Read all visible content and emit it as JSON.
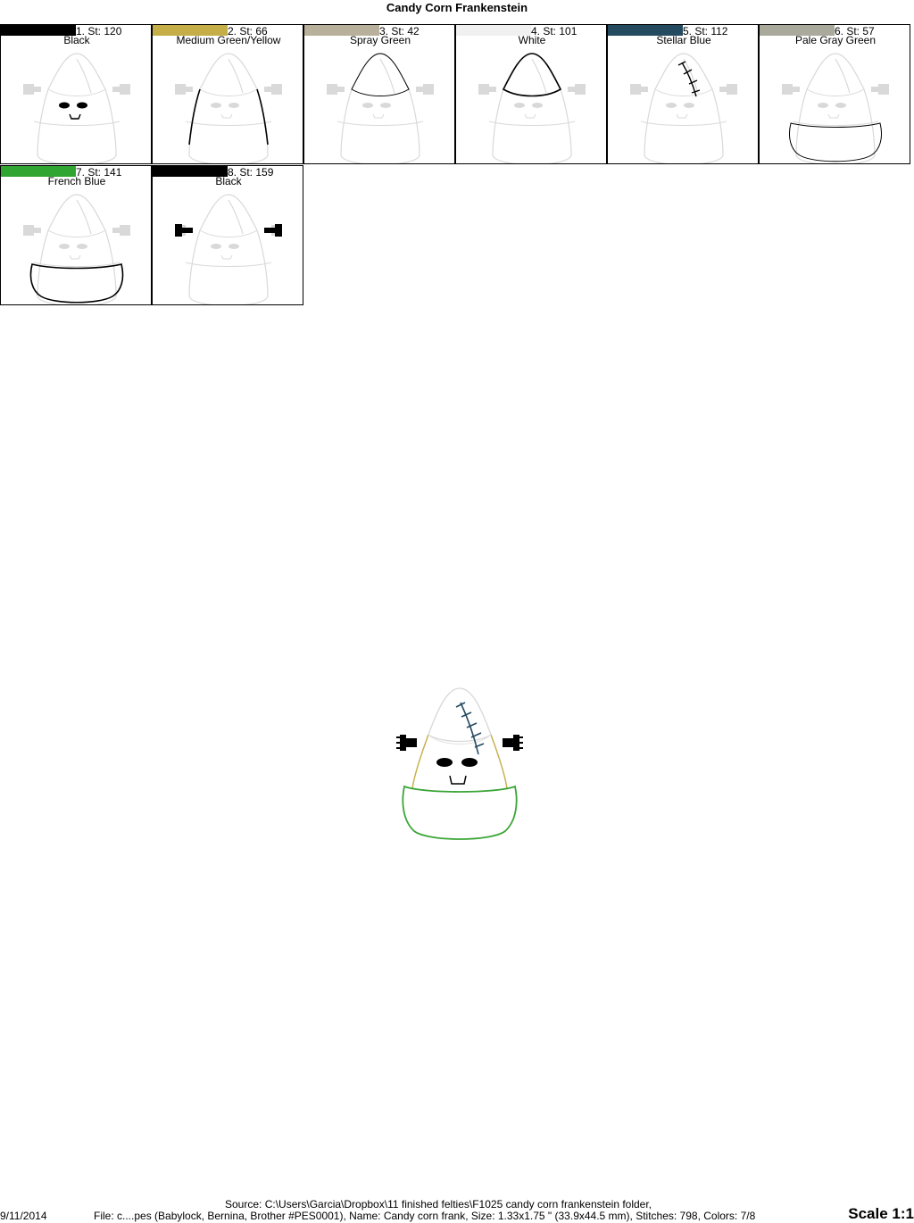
{
  "title": "Candy Corn Frankenstein",
  "colors": [
    {
      "index_label": "1. St: 120",
      "name": "Black",
      "swatch": "#000000",
      "stroke": "#000000",
      "part": "face"
    },
    {
      "index_label": "2. St: 66",
      "name": "Medium Green/Yellow",
      "swatch": "#c5ad48",
      "stroke": "#000000",
      "part": "sides"
    },
    {
      "index_label": "3. St: 42",
      "name": "Spray Green",
      "swatch": "#b8b09b",
      "stroke": "#000000",
      "part": "tip"
    },
    {
      "index_label": "4. St: 101",
      "name": "White",
      "swatch": "#f0f0f0",
      "stroke": "#000000",
      "part": "tip-fill"
    },
    {
      "index_label": "5. St: 112",
      "name": "Stellar Blue",
      "swatch": "#254b61",
      "stroke": "#000000",
      "part": "scar"
    },
    {
      "index_label": "6. St: 57",
      "name": "Pale Gray Green",
      "swatch": "#a9aa9c",
      "stroke": "#000000",
      "part": "bottom"
    },
    {
      "index_label": "7. St: 141",
      "name": "French Blue",
      "swatch": "#31a531",
      "stroke": "#000000",
      "part": "bottom-outline"
    },
    {
      "index_label": "8. St: 159",
      "name": "Black",
      "swatch": "#000000",
      "stroke": "#000000",
      "part": "bolts"
    }
  ],
  "final_design": {
    "tip_color": "#d8d8d8",
    "sides_color": "#c5ad48",
    "bottom_color": "#3aa535",
    "scar_color": "#254b61",
    "face_color": "#000000"
  },
  "footer": {
    "source": "Source: C:\\Users\\Garcia\\Dropbox\\11 finished felties\\F1025 candy corn frankenstein folder,",
    "date": "9/11/2014",
    "file_info": "File: c....pes (Babylock, Bernina, Brother #PES0001), Name: Candy corn frank, Size: 1.33x1.75 \" (33.9x44.5 mm), Stitches: 798, Colors: 7/8",
    "scale": "Scale 1:1"
  }
}
